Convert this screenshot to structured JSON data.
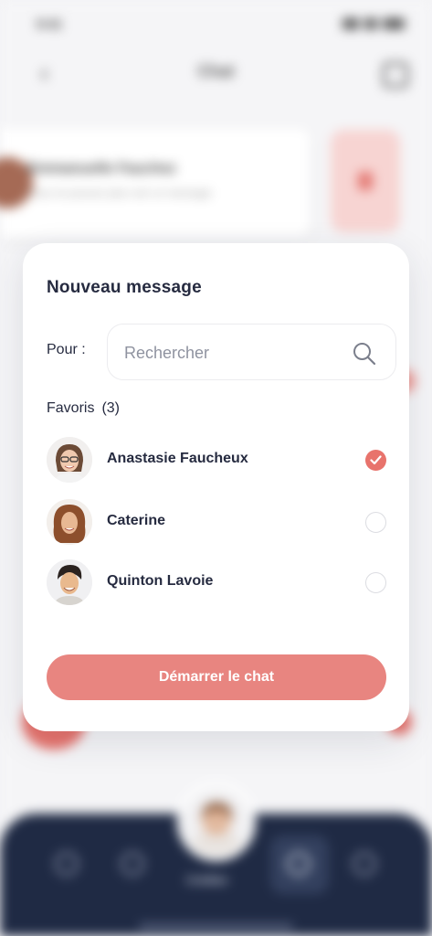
{
  "background": {
    "status_time": "9:41",
    "header_title": "Chat",
    "conversation": {
      "name": "Emmanuelle Fauchez",
      "preview": "Vous ne pouvez plus voir ce message"
    },
    "nav_label": "Créditer"
  },
  "modal": {
    "title": "Nouveau message",
    "to_label": "Pour :",
    "search": {
      "placeholder": "Rechercher",
      "value": ""
    },
    "favorites_label": "Favoris",
    "favorites_count": "(3)",
    "contacts": [
      {
        "name": "Anastasie Faucheux",
        "selected": true
      },
      {
        "name": "Caterine",
        "selected": false
      },
      {
        "name": "Quinton Lavoie",
        "selected": false
      }
    ],
    "start_button": "Démarrer le chat"
  },
  "colors": {
    "accent": "#e8736c",
    "button": "#e88580",
    "navy": "#1f2a44",
    "text": "#262b40"
  }
}
